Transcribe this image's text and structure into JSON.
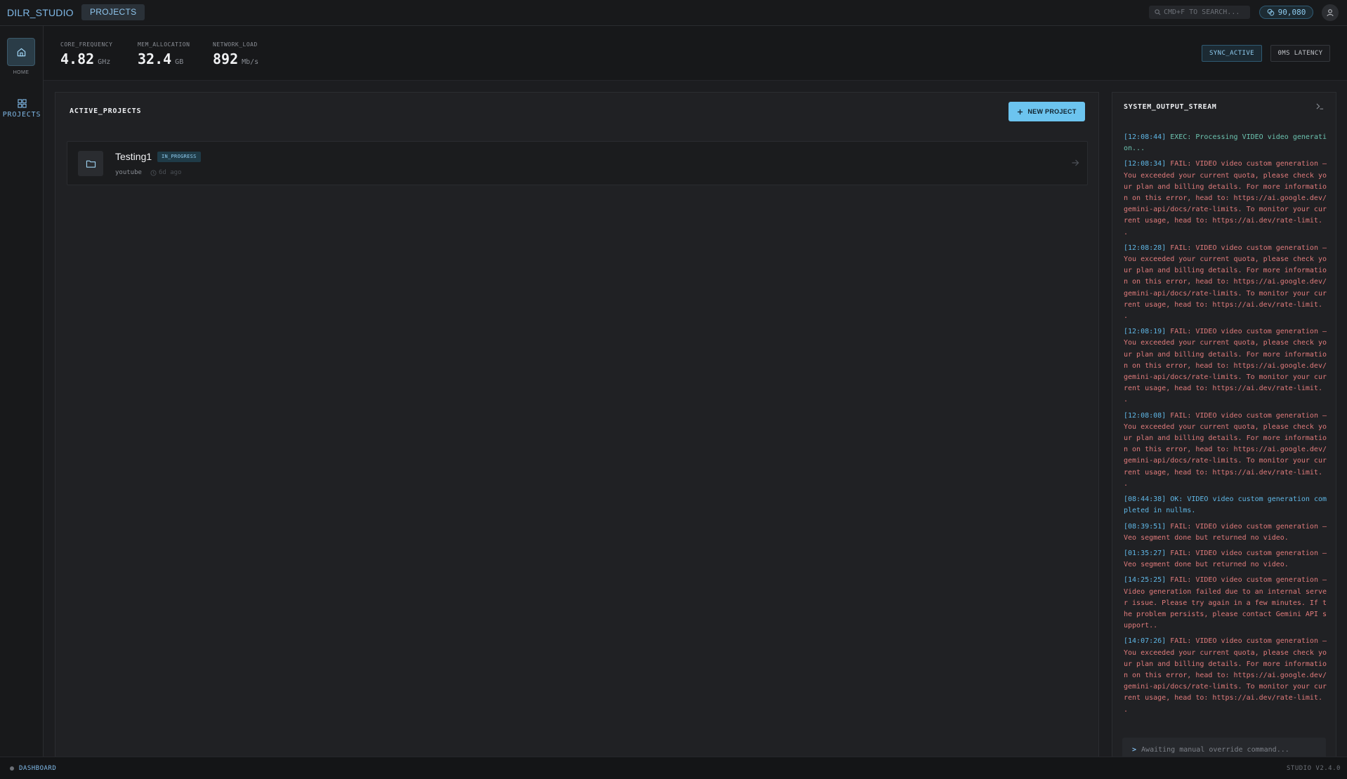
{
  "topbar": {
    "brand": "DILR_STUDIO",
    "tab": "PROJECTS",
    "search_placeholder": "CMD+F TO SEARCH...",
    "credits": "90,080"
  },
  "sidebar": {
    "home_label": "HOME",
    "projects_label": "PROJECTS"
  },
  "metrics": [
    {
      "label": "CORE_FREQUENCY",
      "value": "4.82",
      "unit": "GHz"
    },
    {
      "label": "MEM_ALLOCATION",
      "value": "32.4",
      "unit": "GB"
    },
    {
      "label": "NETWORK_LOAD",
      "value": "892",
      "unit": "Mb/s"
    }
  ],
  "header_buttons": {
    "sync": "SYNC_ACTIVE",
    "latency": "0MS LATENCY"
  },
  "projects": {
    "title": "ACTIVE_PROJECTS",
    "new_button": "NEW PROJECT",
    "items": [
      {
        "name": "Testing1",
        "status": "IN_PROGRESS",
        "platform": "youtube",
        "time": "6d ago"
      }
    ]
  },
  "stream": {
    "title": "SYSTEM_OUTPUT_STREAM",
    "logs": [
      {
        "ts": "[12:08:44]",
        "kind": "exec",
        "text": "EXEC: Processing VIDEO video generation..."
      },
      {
        "ts": "[12:08:34]",
        "kind": "fail",
        "text": "FAIL: VIDEO video custom generation — You exceeded your current quota, please check your plan and billing details. For more information on this error, head to: https://ai.google.dev/gemini-api/docs/rate-limits. To monitor your current usage, head to: https://ai.dev/rate-limit. ."
      },
      {
        "ts": "[12:08:28]",
        "kind": "fail",
        "text": "FAIL: VIDEO video custom generation — You exceeded your current quota, please check your plan and billing details. For more information on this error, head to: https://ai.google.dev/gemini-api/docs/rate-limits. To monitor your current usage, head to: https://ai.dev/rate-limit. ."
      },
      {
        "ts": "[12:08:19]",
        "kind": "fail",
        "text": "FAIL: VIDEO video custom generation — You exceeded your current quota, please check your plan and billing details. For more information on this error, head to: https://ai.google.dev/gemini-api/docs/rate-limits. To monitor your current usage, head to: https://ai.dev/rate-limit. ."
      },
      {
        "ts": "[12:08:08]",
        "kind": "fail",
        "text": "FAIL: VIDEO video custom generation — You exceeded your current quota, please check your plan and billing details. For more information on this error, head to: https://ai.google.dev/gemini-api/docs/rate-limits. To monitor your current usage, head to: https://ai.dev/rate-limit. ."
      },
      {
        "ts": "[08:44:38]",
        "kind": "ok",
        "text": "OK: VIDEO video custom generation completed in nullms."
      },
      {
        "ts": "[08:39:51]",
        "kind": "fail",
        "text": "FAIL: VIDEO video custom generation — Veo segment done but returned no video."
      },
      {
        "ts": "[01:35:27]",
        "kind": "fail",
        "text": "FAIL: VIDEO video custom generation — Veo segment done but returned no video."
      },
      {
        "ts": "[14:25:25]",
        "kind": "fail",
        "text": "FAIL: VIDEO video custom generation — Video generation failed due to an internal server issue. Please try again in a few minutes. If the problem persists, please contact Gemini API support.."
      },
      {
        "ts": "[14:07:26]",
        "kind": "fail",
        "text": "FAIL: VIDEO video custom generation — You exceeded your current quota, please check your plan and billing details. For more information on this error, head to: https://ai.google.dev/gemini-api/docs/rate-limits. To monitor your current usage, head to: https://ai.dev/rate-limit. ."
      }
    ],
    "command_placeholder": "Awaiting manual override command..."
  },
  "footer": {
    "left": "DASHBOARD",
    "right": "STUDIO V2.4.0"
  },
  "colors": {
    "accent": "#6cc4ef",
    "fail": "#e07b7b",
    "exec": "#6cc4b0"
  }
}
